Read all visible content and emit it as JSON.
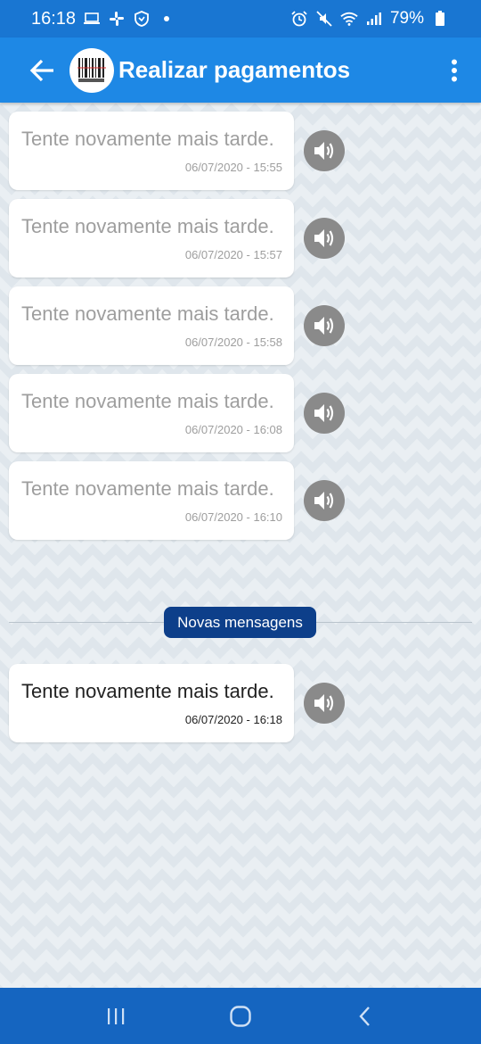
{
  "status_bar": {
    "time": "16:18",
    "battery_percent": "79%",
    "background_color": "#1976d2"
  },
  "app_bar": {
    "title": "Realizar pagamentos",
    "avatar_icon": "barcode-icon",
    "back_icon": "arrow-left-icon",
    "menu_icon": "more-vert-icon",
    "background_color": "#1e88e5"
  },
  "messages": [
    {
      "text": "Tente novamente mais tarde.",
      "time": "06/07/2020 - 15:55"
    },
    {
      "text": "Tente novamente mais tarde.",
      "time": "06/07/2020 - 15:57"
    },
    {
      "text": "Tente novamente mais tarde.",
      "time": "06/07/2020 - 15:58"
    },
    {
      "text": "Tente novamente mais tarde.",
      "time": "06/07/2020 - 16:08"
    },
    {
      "text": "Tente novamente mais tarde.",
      "time": "06/07/2020 - 16:10"
    }
  ],
  "new_messages_label": "Novas mensagens",
  "new_messages": [
    {
      "text": "Tente novamente mais tarde.",
      "time": "06/07/2020 - 16:18"
    }
  ],
  "nav_bar": {
    "recents_icon": "recent-apps-icon",
    "home_icon": "home-icon",
    "back_icon": "chevron-left-icon",
    "background_color": "#1565c0"
  }
}
